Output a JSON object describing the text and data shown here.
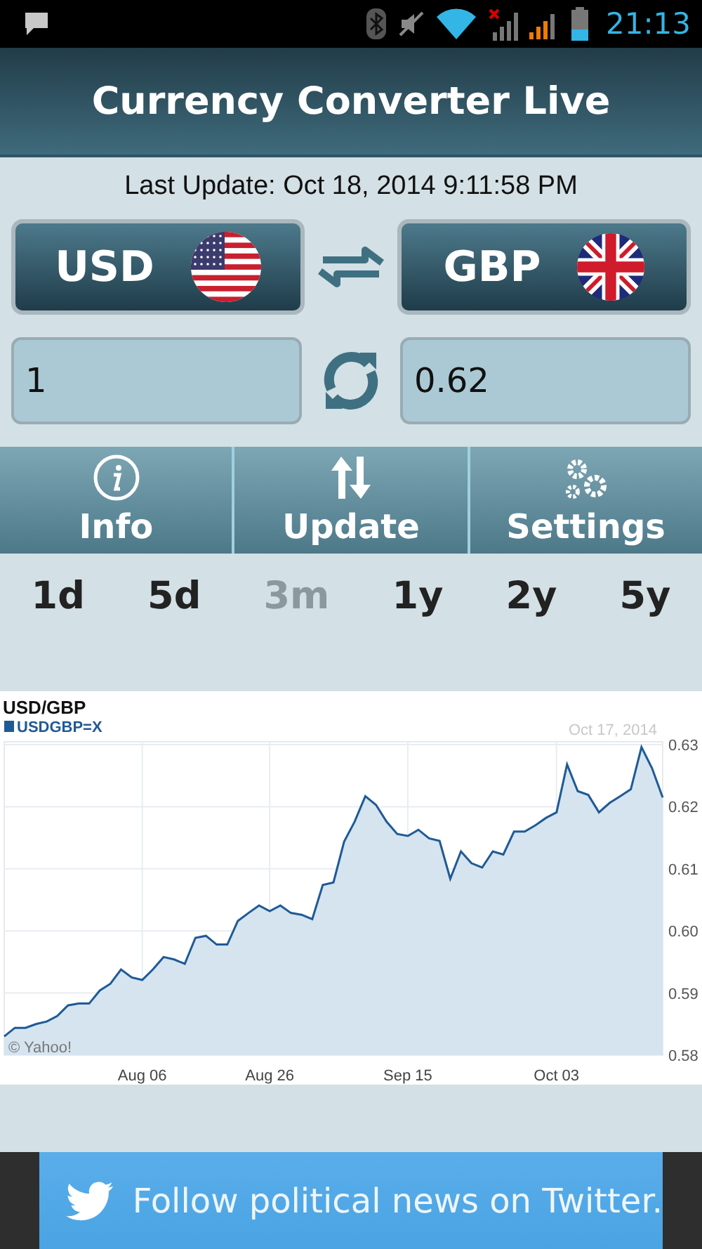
{
  "status_bar": {
    "time": "21:13"
  },
  "app_bar": {
    "title": "Currency Converter Live"
  },
  "last_update": "Last Update: Oct 18, 2014 9:11:58 PM",
  "currencies": [
    {
      "code": "USD",
      "kind": "us"
    },
    {
      "code": "GBP",
      "kind": "uk"
    }
  ],
  "amounts": [
    {
      "value": "1"
    },
    {
      "value": "0.62"
    }
  ],
  "nav": [
    {
      "label": "Info",
      "kind": "info"
    },
    {
      "label": "Update",
      "kind": "update"
    },
    {
      "label": "Settings",
      "kind": "settings"
    }
  ],
  "periods": [
    {
      "label": "1d",
      "selected": false
    },
    {
      "label": "5d",
      "selected": false
    },
    {
      "label": "3m",
      "selected": true
    },
    {
      "label": "1y",
      "selected": false
    },
    {
      "label": "2y",
      "selected": false
    },
    {
      "label": "5y",
      "selected": false
    }
  ],
  "chart": {
    "date_label": "Oct 17, 2014",
    "credit": "© Yahoo!",
    "chart_data": {
      "type": "area",
      "title": "USD/GBP",
      "grid": true,
      "ylim": [
        0.58,
        0.63
      ],
      "yticks": [
        {
          "value": 0.63,
          "label": "0.63"
        },
        {
          "value": 0.62,
          "label": "0.62"
        },
        {
          "value": 0.61,
          "label": "0.61"
        },
        {
          "value": 0.6,
          "label": "0.60"
        },
        {
          "value": 0.59,
          "label": "0.59"
        },
        {
          "value": 0.58,
          "label": "0.58"
        }
      ],
      "categories": [
        null,
        null,
        null,
        null,
        null,
        null,
        null,
        null,
        null,
        null,
        null,
        null,
        null,
        "Aug 06",
        null,
        null,
        null,
        null,
        null,
        null,
        null,
        null,
        null,
        null,
        null,
        "Aug 26",
        null,
        null,
        null,
        null,
        null,
        null,
        null,
        null,
        null,
        null,
        null,
        null,
        "Sep 15",
        null,
        null,
        null,
        null,
        null,
        null,
        null,
        null,
        null,
        null,
        null,
        null,
        null,
        "Oct 03",
        null,
        null,
        null,
        null,
        null,
        null,
        null,
        null,
        null,
        null
      ],
      "series": [
        {
          "name": "USDGBP=X",
          "color": "#1f5a96",
          "values": [
            0.583,
            0.5844,
            0.5844,
            0.585,
            0.5854,
            0.5863,
            0.588,
            0.5883,
            0.5883,
            0.5904,
            0.5915,
            0.5938,
            0.5925,
            0.5921,
            0.5938,
            0.5958,
            0.5954,
            0.5947,
            0.5989,
            0.5992,
            0.5978,
            0.5978,
            0.6016,
            0.6029,
            0.6041,
            0.6032,
            0.6041,
            0.6029,
            0.6026,
            0.6019,
            0.6074,
            0.6078,
            0.6144,
            0.6176,
            0.6217,
            0.6203,
            0.6176,
            0.6156,
            0.6153,
            0.6163,
            0.6149,
            0.6145,
            0.6084,
            0.6128,
            0.6109,
            0.6102,
            0.6128,
            0.6123,
            0.616,
            0.616,
            0.617,
            0.6182,
            0.6191,
            0.6268,
            0.6225,
            0.6219,
            0.6191,
            0.6206,
            0.6217,
            0.6228,
            0.6296,
            0.6262,
            0.6215
          ]
        }
      ]
    }
  },
  "ad": {
    "text": "Follow political news on Twitter."
  }
}
